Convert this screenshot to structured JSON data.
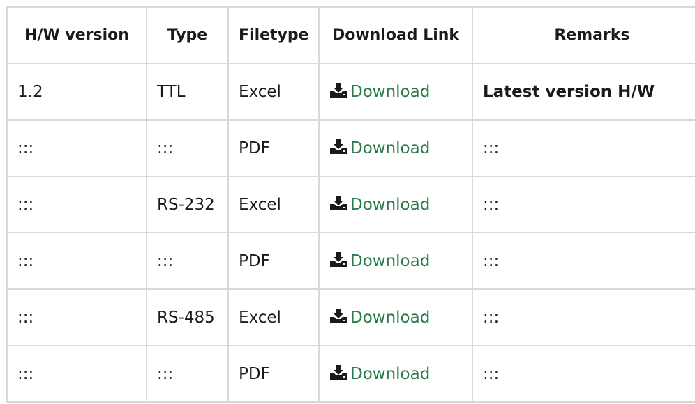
{
  "headers": [
    "H/W version",
    "Type",
    "Filetype",
    "Download Link",
    "Remarks"
  ],
  "rows": [
    {
      "hw": "1.2",
      "type": "TTL",
      "filetype": "Excel",
      "link": "Download",
      "remarks": "Latest version H/W"
    },
    {
      "hw": ":::",
      "type": ":::",
      "filetype": "PDF",
      "link": "Download",
      "remarks": ":::"
    },
    {
      "hw": ":::",
      "type": "RS-232",
      "filetype": "Excel",
      "link": "Download",
      "remarks": ":::"
    },
    {
      "hw": ":::",
      "type": ":::",
      "filetype": "PDF",
      "link": "Download",
      "remarks": ":::"
    },
    {
      "hw": ":::",
      "type": "RS-485",
      "filetype": "Excel",
      "link": "Download",
      "remarks": ":::"
    },
    {
      "hw": ":::",
      "type": ":::",
      "filetype": "PDF",
      "link": "Download",
      "remarks": ":::"
    }
  ],
  "colors": {
    "link": "#2a7a4b",
    "border": "#d9d9d9"
  },
  "icons": {
    "download": "download-icon"
  }
}
